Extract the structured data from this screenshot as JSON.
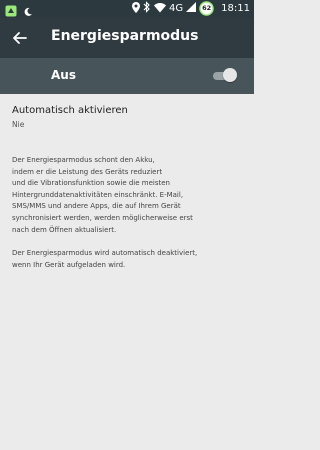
{
  "status_bar": {
    "time": "18:11",
    "network": "4G",
    "battery_level": "62",
    "icons": [
      "app-notification-icon",
      "moon-icon",
      "location-icon",
      "bluetooth-icon",
      "wifi-icon",
      "signal-icon",
      "battery-icon"
    ],
    "accent": "#9be87a"
  },
  "app_bar": {
    "back_icon": "arrow-back-icon",
    "title": "Energiesparmodus"
  },
  "master_switch": {
    "label": "Aus",
    "state": "off"
  },
  "preference": {
    "title": "Automatisch aktivieren",
    "summary": "Nie"
  },
  "description": {
    "paragraph1_lines": [
      "Der Energiesparmodus schont den Akku,",
      "indem er die Leistung des Geräts reduziert",
      "und die Vibrationsfunktion sowie die meisten",
      "Hintergrunddatenaktivitäten einschränkt. E-Mail,",
      "SMS/MMS und andere Apps, die auf Ihrem Gerät",
      "synchronisiert werden, werden möglicherweise erst",
      "nach dem Öffnen aktualisiert."
    ],
    "paragraph2_lines": [
      "Der Energiesparmodus wird automatisch deaktiviert,",
      "wenn Ihr Gerät aufgeladen wird."
    ]
  },
  "colors": {
    "status_bar": "#2c3a3f",
    "app_bar": "#2f3b40",
    "switch_bar": "#47555a",
    "background": "#ebebeb"
  }
}
